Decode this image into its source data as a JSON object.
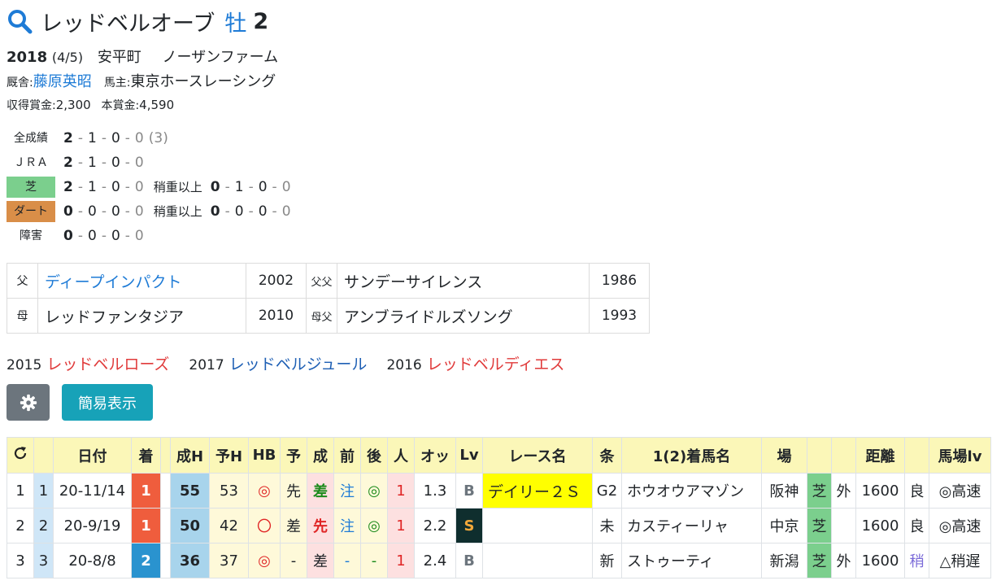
{
  "horse": {
    "name": "レッドベルオーブ",
    "sex": "牡",
    "age": "2",
    "birth_year": "2018",
    "birth_date": "(4/5)",
    "birthplace": "安平町",
    "breeder": "ノーザンファーム",
    "trainer_label": "厩舎:",
    "trainer": "藤原英昭",
    "owner_label": "馬主:",
    "owner": "東京ホースレーシング",
    "earned_label": "収得賞金:",
    "earned": "2,300",
    "prize_label": "本賞金:",
    "prize": "4,590"
  },
  "records": {
    "all": {
      "label": "全成績",
      "w": "2",
      "s": "1",
      "t": "0",
      "o": "0",
      "extra": "(3)"
    },
    "jra": {
      "label": "ＪＲＡ",
      "w": "2",
      "s": "1",
      "t": "0",
      "o": "0"
    },
    "turf": {
      "label": "芝",
      "w": "2",
      "s": "1",
      "t": "0",
      "o": "0",
      "sub_label": "稍重以上",
      "sw": "0",
      "ss": "1",
      "st": "0",
      "so": "0"
    },
    "dirt": {
      "label": "ダート",
      "w": "0",
      "s": "0",
      "t": "0",
      "o": "0",
      "sub_label": "稍重以上",
      "sw": "0",
      "ss": "0",
      "st": "0",
      "so": "0"
    },
    "obstacle": {
      "label": "障害",
      "w": "0",
      "s": "0",
      "t": "0",
      "o": "0"
    }
  },
  "pedigree": {
    "sire_label": "父",
    "sire": "ディープインパクト",
    "sire_year": "2002",
    "sire_sire_label": "父父",
    "sire_sire": "サンデーサイレンス",
    "sire_sire_year": "1986",
    "dam_label": "母",
    "dam": "レッドファンタジア",
    "dam_year": "2010",
    "dam_sire_label": "母父",
    "dam_sire": "アンブライドルズソング",
    "dam_sire_year": "1993"
  },
  "siblings": [
    {
      "year": "2015",
      "name": "レッドベルローズ",
      "color": "red"
    },
    {
      "year": "2017",
      "name": "レッドベルジュール",
      "color": "blue"
    },
    {
      "year": "2016",
      "name": "レッドベルディエス",
      "color": "red"
    }
  ],
  "buttons": {
    "simple": "簡易表示"
  },
  "table": {
    "headers": [
      "",
      "",
      "日付",
      "着",
      "",
      "成H",
      "予H",
      "HB",
      "予",
      "成",
      "前",
      "後",
      "人",
      "オッ",
      "Lv",
      "レース名",
      "条",
      "1(2)着馬名",
      "場",
      "",
      "",
      "距離",
      "",
      "馬場lv"
    ],
    "rows": [
      {
        "no": "1",
        "no2": "1",
        "date": "20-11/14",
        "result": "1",
        "seiH": "55",
        "yoH": "53",
        "hb": "◎",
        "yo": "先",
        "sei": "差",
        "mae": "注",
        "ato": "◎",
        "ninki": "1",
        "odds": "1.3",
        "lv": "B",
        "race": "デイリー２Ｓ",
        "cond": "G2",
        "winner": "ホウオウアマゾン",
        "place": "阪神",
        "surface": "芝",
        "course": "外",
        "dist": "1600",
        "going": "良",
        "baba": "◎高速"
      },
      {
        "no": "2",
        "no2": "2",
        "date": "20-9/19",
        "result": "1",
        "seiH": "50",
        "yoH": "42",
        "hb": "〇",
        "yo": "差",
        "sei": "先",
        "mae": "注",
        "ato": "◎",
        "ninki": "1",
        "odds": "2.2",
        "lv": "S",
        "race": "",
        "cond": "未",
        "winner": "カスティーリャ",
        "place": "中京",
        "surface": "芝",
        "course": "",
        "dist": "1600",
        "going": "良",
        "baba": "◎高速"
      },
      {
        "no": "3",
        "no2": "3",
        "date": "20-8/8",
        "result": "2",
        "seiH": "36",
        "yoH": "37",
        "hb": "◎",
        "yo": "-",
        "sei": "差",
        "mae": "-",
        "ato": "-",
        "ninki": "1",
        "odds": "2.4",
        "lv": "B",
        "race": "",
        "cond": "新",
        "winner": "ストゥーティ",
        "place": "新潟",
        "surface": "芝",
        "course": "外",
        "dist": "1600",
        "going": "稍",
        "baba": "△稍遅"
      }
    ]
  }
}
